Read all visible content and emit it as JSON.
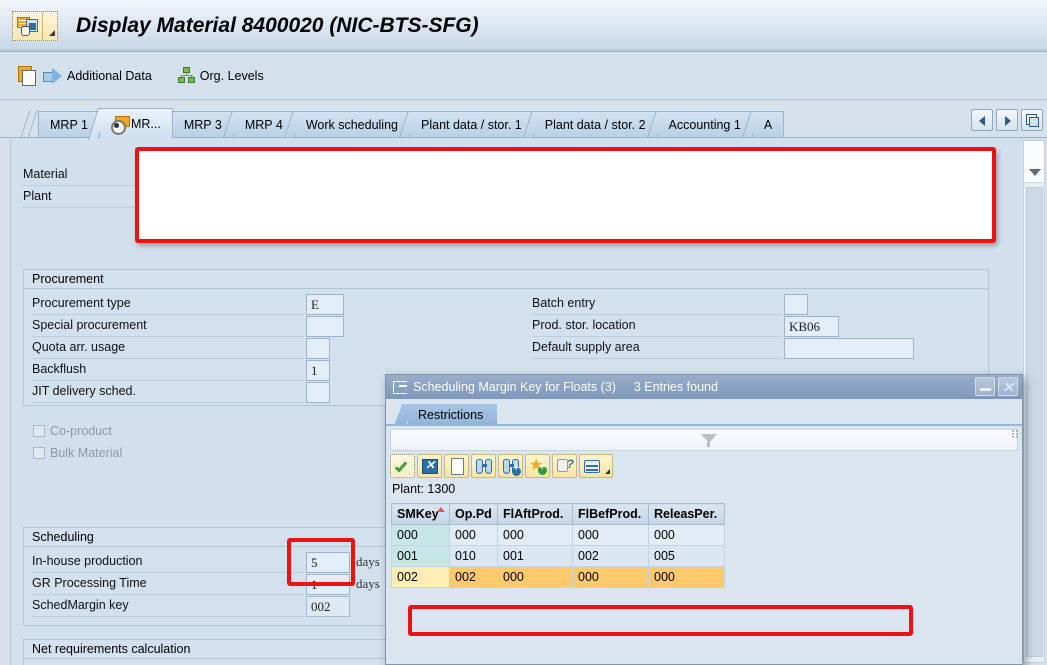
{
  "window": {
    "title": "Display Material 8400020 (NIC-BTS-SFG)",
    "app_icon": "material-display-icon"
  },
  "toolbar": {
    "items": [
      {
        "icon": "copy-icon",
        "label": ""
      },
      {
        "icon": "arrow-right-icon",
        "label": "Additional Data"
      },
      {
        "icon": "org-levels-icon",
        "label": "Org. Levels"
      }
    ],
    "additional_data_label": "Additional Data",
    "org_levels_label": "Org. Levels"
  },
  "tabs": {
    "items": [
      {
        "label": "MRP 1",
        "selected": false
      },
      {
        "label": "MR...",
        "selected": true,
        "icon": "mrp2-active-icon"
      },
      {
        "label": "MRP 3",
        "selected": false
      },
      {
        "label": "MRP 4",
        "selected": false
      },
      {
        "label": "Work scheduling",
        "selected": false
      },
      {
        "label": "Plant data / stor. 1",
        "selected": false
      },
      {
        "label": "Plant data / stor. 2",
        "selected": false
      },
      {
        "label": "Accounting 1",
        "selected": false
      },
      {
        "label": "A",
        "selected": false
      }
    ],
    "nav": {
      "prev": "tab-scroll-left",
      "next": "tab-scroll-right",
      "list": "tab-list"
    }
  },
  "header_fields": {
    "material_label": "Material",
    "plant_label": "Plant"
  },
  "procurement": {
    "title": "Procurement",
    "left_fields": [
      {
        "label": "Procurement type",
        "value": "E"
      },
      {
        "label": "Special procurement",
        "value": ""
      },
      {
        "label": "Quota arr. usage",
        "value": ""
      },
      {
        "label": "Backflush",
        "value": "1"
      },
      {
        "label": "JIT delivery sched.",
        "value": ""
      }
    ],
    "checkboxes": [
      {
        "label": "Co-product",
        "checked": false
      },
      {
        "label": "Bulk Material",
        "checked": false
      }
    ],
    "right_fields": [
      {
        "label": "Batch entry",
        "value": ""
      },
      {
        "label": "Prod. stor. location",
        "value": "KB06"
      },
      {
        "label": "Default supply area",
        "value": ""
      }
    ]
  },
  "scheduling": {
    "title": "Scheduling",
    "fields": [
      {
        "label": "In-house production",
        "value": "5",
        "unit": "days"
      },
      {
        "label": "GR Processing Time",
        "value": "1",
        "unit": "days"
      },
      {
        "label": "SchedMargin key",
        "value": "002",
        "unit": ""
      }
    ]
  },
  "net_requirements": {
    "title": "Net requirements calculation"
  },
  "dialog": {
    "title": "Scheduling Margin Key for Floats (3)",
    "entries_found": "3 Entries found",
    "title_icon": "popup-help-icon",
    "minimize_label": "—",
    "close_label": "✕",
    "tab_label": "Restrictions",
    "filter_icon": "funnel-icon",
    "toolbar_icons": [
      "check-green-icon",
      "cancel-x-icon",
      "new-page-icon",
      "find-icon",
      "find-next-icon",
      "favorite-add-icon",
      "help-hand-icon",
      "print-icon"
    ],
    "plant_line": "Plant: 1300",
    "table": {
      "columns": [
        "SMKey",
        "Op.Pd",
        "FlAftProd.",
        "FlBefProd.",
        "ReleasPer."
      ],
      "sorted_column": "SMKey",
      "rows": [
        {
          "cells": [
            "000",
            "000",
            "000",
            "000",
            "000"
          ],
          "selected": false
        },
        {
          "cells": [
            "001",
            "010",
            "001",
            "002",
            "005"
          ],
          "selected": false
        },
        {
          "cells": [
            "002",
            "002",
            "000",
            "000",
            "000"
          ],
          "selected": true
        }
      ]
    }
  },
  "colors": {
    "accent_red": "#ee1111",
    "selected_row": "#fcc96b",
    "dialog_title": "#8ba2c2",
    "background": "#d7e1ec"
  }
}
